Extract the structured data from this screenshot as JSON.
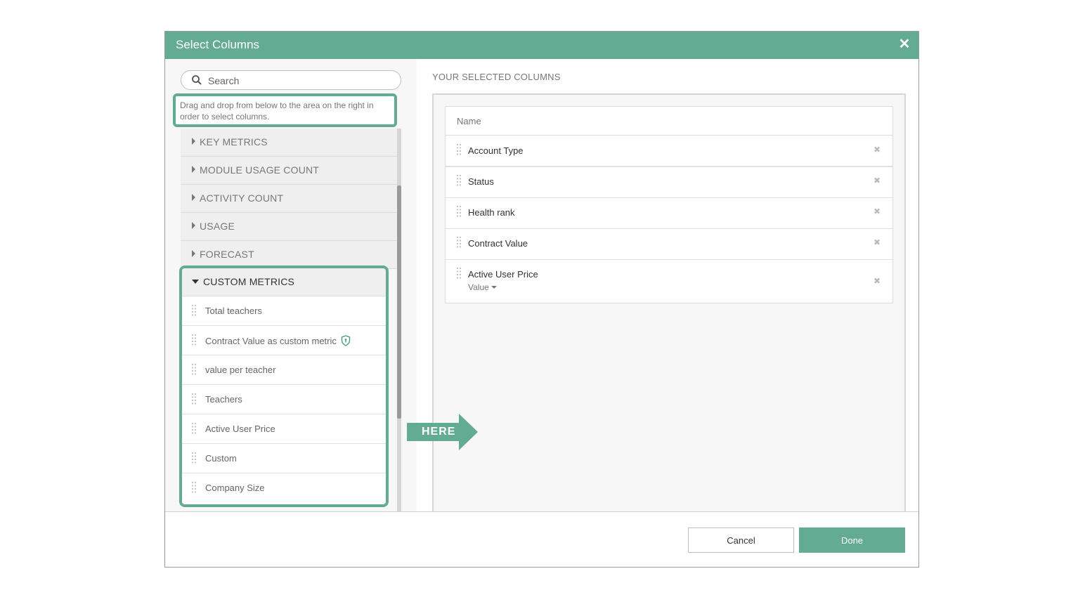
{
  "dialog": {
    "title": "Select Columns",
    "close_icon": "close-icon"
  },
  "search": {
    "placeholder": "Search",
    "value": ""
  },
  "hint": "Drag and drop from below to the area on the right in order to select columns.",
  "categories": [
    {
      "label": "KEY METRICS",
      "expanded": false
    },
    {
      "label": "MODULE USAGE COUNT",
      "expanded": false
    },
    {
      "label": "ACTIVITY COUNT",
      "expanded": false
    },
    {
      "label": "USAGE",
      "expanded": false
    },
    {
      "label": "FORECAST",
      "expanded": false
    }
  ],
  "custom_metrics": {
    "label": "CUSTOM METRICS",
    "expanded": true,
    "items": [
      {
        "label": "Total teachers"
      },
      {
        "label": "Contract Value as custom metric",
        "icon": "shield-icon"
      },
      {
        "label": "value per teacher"
      },
      {
        "label": "Teachers"
      },
      {
        "label": "Active User Price"
      },
      {
        "label": "Custom"
      },
      {
        "label": "Company Size"
      }
    ]
  },
  "annotation": {
    "arrow_label": "HERE"
  },
  "selected": {
    "title": "YOUR SELECTED COLUMNS",
    "header": "Name",
    "rows": [
      {
        "label": "Account Type"
      },
      {
        "label": "Status"
      },
      {
        "label": "Health rank"
      },
      {
        "label": "Contract Value"
      },
      {
        "label": "Active User Price",
        "sub_select": "Value"
      }
    ]
  },
  "footer": {
    "cancel_label": "Cancel",
    "done_label": "Done"
  },
  "colors": {
    "accent": "#63ab92",
    "panel_bg": "#f7f7f7"
  }
}
